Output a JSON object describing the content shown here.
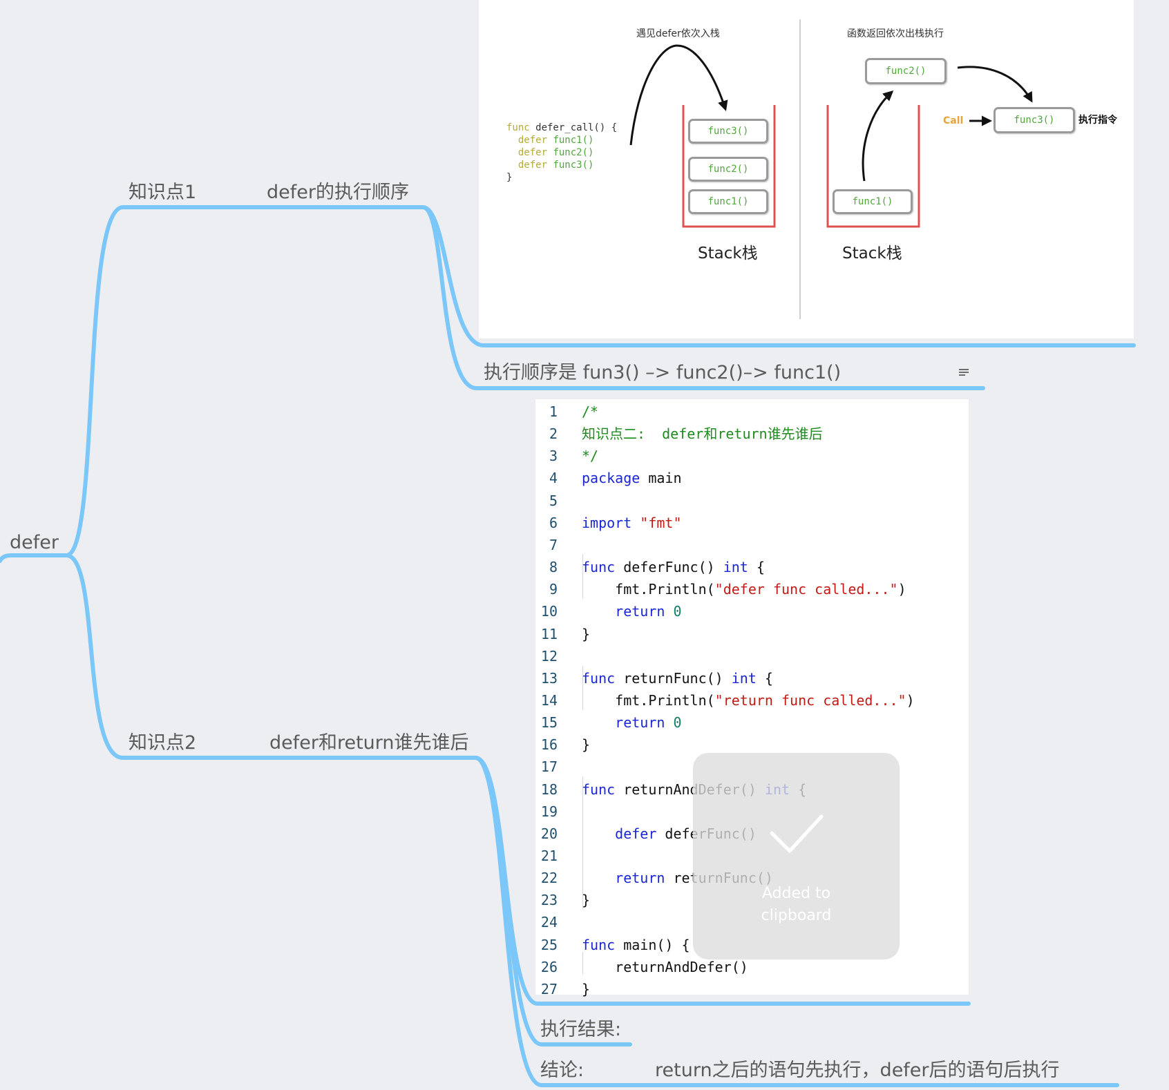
{
  "mindmap": {
    "root": {
      "label": "defer"
    },
    "branch1": {
      "label": "知识点1",
      "topic": "defer的执行顺序",
      "note": "执行顺序是 fun3() –> func2()–> func1()",
      "note_icon": "note-lines-icon"
    },
    "branch2": {
      "label": "知识点2",
      "topic": "defer和return谁先谁后",
      "result_label": "执行结果:",
      "conclusion_label": "结论:",
      "conclusion_text": "return之后的语句先执行，defer后的语句后执行"
    },
    "line_color": "#7cc7f9"
  },
  "diagram": {
    "push_caption": "遇见defer依次入栈",
    "pop_caption": "函数返回依次出栈执行",
    "code": {
      "line1_kw": "func",
      "line1_rest": " defer_call() {",
      "defer_kw": "defer",
      "calls": [
        " func1()",
        " func2()",
        " func3()"
      ],
      "close": "}"
    },
    "left_stack": [
      "func3()",
      "func2()",
      "func1()"
    ],
    "right_stack": [
      "func1()"
    ],
    "popped": "func2()",
    "executing": "func3()",
    "call_label": "Call",
    "exec_label": "执行指令",
    "stack_caption": "Stack栈",
    "stack_color": "#e05252"
  },
  "code_listing": {
    "lines": [
      {
        "n": "1",
        "parts": [
          [
            "cmt",
            "/*"
          ]
        ]
      },
      {
        "n": "2",
        "parts": [
          [
            "cmt",
            "知识点二:  defer和return谁先谁后"
          ]
        ]
      },
      {
        "n": "3",
        "parts": [
          [
            "cmt",
            "*/"
          ]
        ]
      },
      {
        "n": "4",
        "parts": [
          [
            "kw2",
            "package"
          ],
          [
            "",
            " main"
          ]
        ]
      },
      {
        "n": "5",
        "parts": []
      },
      {
        "n": "6",
        "parts": [
          [
            "kw2",
            "import"
          ],
          [
            "",
            " "
          ],
          [
            "str",
            "\"fmt\""
          ]
        ]
      },
      {
        "n": "7",
        "parts": []
      },
      {
        "n": "8",
        "parts": [
          [
            "kw2",
            "func"
          ],
          [
            "",
            " deferFunc() "
          ],
          [
            "kw2",
            "int"
          ],
          [
            "",
            " {"
          ]
        ]
      },
      {
        "n": "9",
        "parts": [
          [
            "",
            "    fmt.Println("
          ],
          [
            "str",
            "\"defer func called...\""
          ],
          [
            "",
            ")"
          ]
        ]
      },
      {
        "n": "10",
        "parts": [
          [
            "",
            "    "
          ],
          [
            "kw2",
            "return"
          ],
          [
            "",
            " "
          ],
          [
            "num",
            "0"
          ]
        ]
      },
      {
        "n": "11",
        "parts": [
          [
            "",
            "}"
          ]
        ]
      },
      {
        "n": "12",
        "parts": []
      },
      {
        "n": "13",
        "parts": [
          [
            "kw2",
            "func"
          ],
          [
            "",
            " returnFunc() "
          ],
          [
            "kw2",
            "int"
          ],
          [
            "",
            " {"
          ]
        ]
      },
      {
        "n": "14",
        "parts": [
          [
            "",
            "    fmt.Println("
          ],
          [
            "str",
            "\"return func called...\""
          ],
          [
            "",
            ")"
          ]
        ]
      },
      {
        "n": "15",
        "parts": [
          [
            "",
            "    "
          ],
          [
            "kw2",
            "return"
          ],
          [
            "",
            " "
          ],
          [
            "num",
            "0"
          ]
        ]
      },
      {
        "n": "16",
        "parts": [
          [
            "",
            "}"
          ]
        ]
      },
      {
        "n": "17",
        "parts": []
      },
      {
        "n": "18",
        "parts": [
          [
            "kw2",
            "func"
          ],
          [
            "",
            " returnAndDefer() "
          ],
          [
            "kw2",
            "int"
          ],
          [
            "",
            " {"
          ]
        ]
      },
      {
        "n": "19",
        "parts": []
      },
      {
        "n": "20",
        "parts": [
          [
            "",
            "    "
          ],
          [
            "kw2",
            "defer"
          ],
          [
            "",
            " deferFunc()"
          ]
        ]
      },
      {
        "n": "21",
        "parts": []
      },
      {
        "n": "22",
        "parts": [
          [
            "",
            "    "
          ],
          [
            "kw2",
            "return"
          ],
          [
            "",
            " returnFunc()"
          ]
        ]
      },
      {
        "n": "23",
        "parts": [
          [
            "",
            "}"
          ]
        ]
      },
      {
        "n": "24",
        "parts": []
      },
      {
        "n": "25",
        "parts": [
          [
            "kw2",
            "func"
          ],
          [
            "",
            " main() {"
          ]
        ]
      },
      {
        "n": "26",
        "parts": [
          [
            "",
            "    returnAndDefer()"
          ]
        ]
      },
      {
        "n": "27",
        "parts": [
          [
            "",
            "}"
          ]
        ]
      }
    ]
  },
  "toast": {
    "icon": "checkmark-icon",
    "message_line1": "Added to",
    "message_line2": "clipboard"
  }
}
